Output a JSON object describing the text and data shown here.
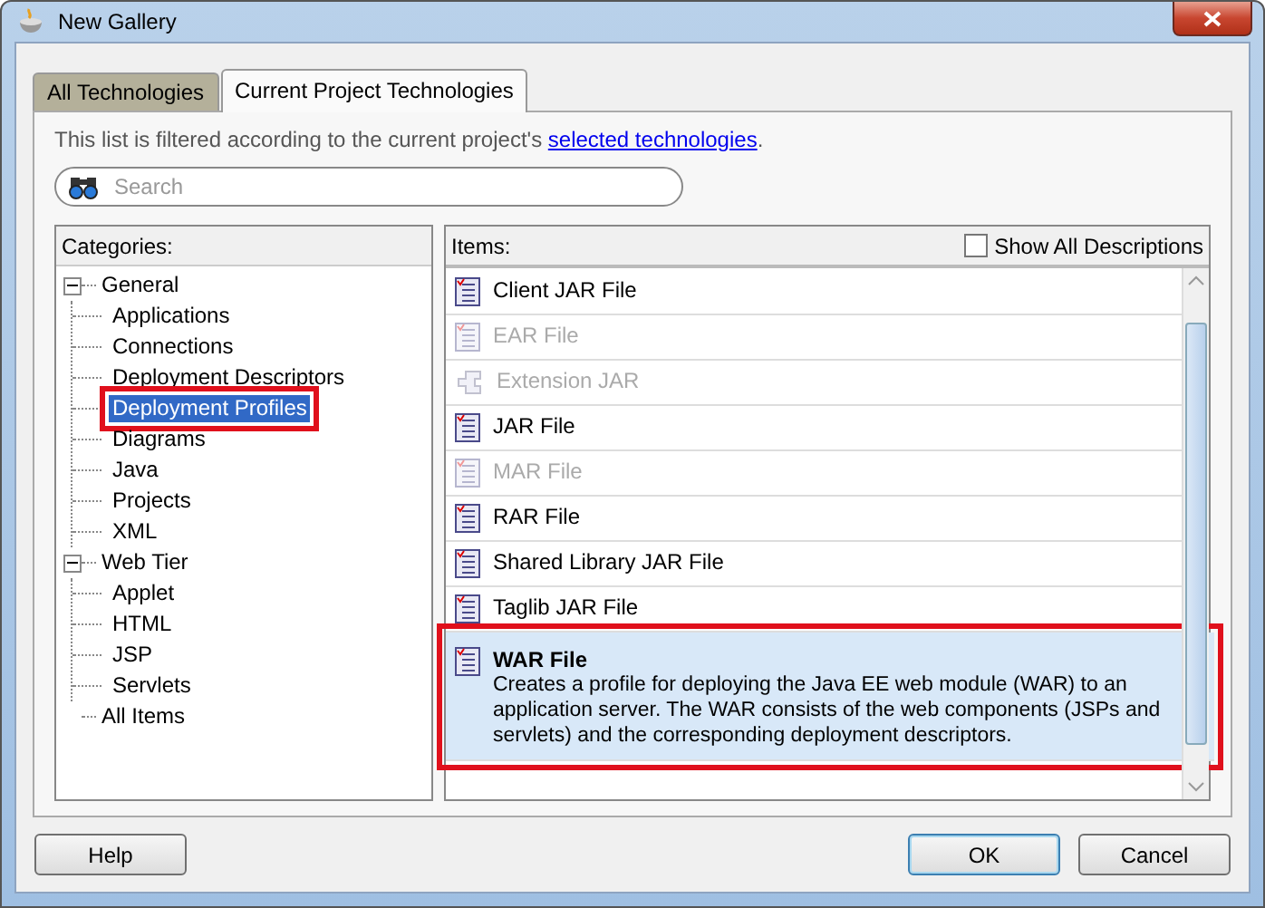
{
  "window": {
    "title": "New Gallery"
  },
  "tabs": [
    {
      "label": "All Technologies",
      "selected": false
    },
    {
      "label": "Current Project Technologies",
      "selected": true
    }
  ],
  "filter_note": {
    "text": "This list is filtered according to the current project's",
    "link": "selected technologies",
    "end": "."
  },
  "search": {
    "placeholder": "Search"
  },
  "categories": {
    "label": "Categories:",
    "tree": [
      {
        "label": "General",
        "expanded": true,
        "selected": false,
        "highlighted": false,
        "children": [
          {
            "label": "Applications",
            "selected": false,
            "highlighted": false
          },
          {
            "label": "Connections",
            "selected": false,
            "highlighted": false
          },
          {
            "label": "Deployment Descriptors",
            "selected": false,
            "highlighted": false
          },
          {
            "label": "Deployment Profiles",
            "selected": true,
            "highlighted": true
          },
          {
            "label": "Diagrams",
            "selected": false,
            "highlighted": false
          },
          {
            "label": "Java",
            "selected": false,
            "highlighted": false
          },
          {
            "label": "Projects",
            "selected": false,
            "highlighted": false
          },
          {
            "label": "XML",
            "selected": false,
            "highlighted": false
          }
        ]
      },
      {
        "label": "Web Tier",
        "expanded": true,
        "selected": false,
        "highlighted": false,
        "children": [
          {
            "label": "Applet",
            "selected": false,
            "highlighted": false
          },
          {
            "label": "HTML",
            "selected": false,
            "highlighted": false
          },
          {
            "label": "JSP",
            "selected": false,
            "highlighted": false
          },
          {
            "label": "Servlets",
            "selected": false,
            "highlighted": false
          }
        ]
      },
      {
        "label": "All Items",
        "selected": false,
        "highlighted": false
      }
    ]
  },
  "items": {
    "label": "Items:",
    "show_all_descriptions": {
      "label": "Show All Descriptions",
      "checked": false
    },
    "list": [
      {
        "name": "Client JAR File",
        "kind": "document",
        "disabled": false,
        "selected": false,
        "highlighted": false
      },
      {
        "name": "EAR File",
        "kind": "document",
        "disabled": true,
        "selected": false,
        "highlighted": false
      },
      {
        "name": "Extension JAR",
        "kind": "plugin",
        "disabled": true,
        "selected": false,
        "highlighted": false
      },
      {
        "name": "JAR File",
        "kind": "document",
        "disabled": false,
        "selected": false,
        "highlighted": false
      },
      {
        "name": "MAR File",
        "kind": "document",
        "disabled": true,
        "selected": false,
        "highlighted": false
      },
      {
        "name": "RAR File",
        "kind": "document",
        "disabled": false,
        "selected": false,
        "highlighted": false
      },
      {
        "name": "Shared Library JAR File",
        "kind": "document",
        "disabled": false,
        "selected": false,
        "highlighted": false
      },
      {
        "name": "Taglib JAR File",
        "kind": "document",
        "disabled": false,
        "selected": false,
        "highlighted": false
      },
      {
        "name": "WAR File",
        "kind": "document",
        "disabled": false,
        "selected": true,
        "highlighted": true,
        "description": "Creates a profile for deploying the Java EE web module (WAR) to an application server. The WAR consists of the web components (JSPs and servlets) and the corresponding deployment descriptors."
      }
    ]
  },
  "buttons": [
    {
      "label": "Help",
      "default": false
    },
    {
      "label": "OK",
      "default": true
    },
    {
      "label": "Cancel",
      "default": false
    }
  ]
}
